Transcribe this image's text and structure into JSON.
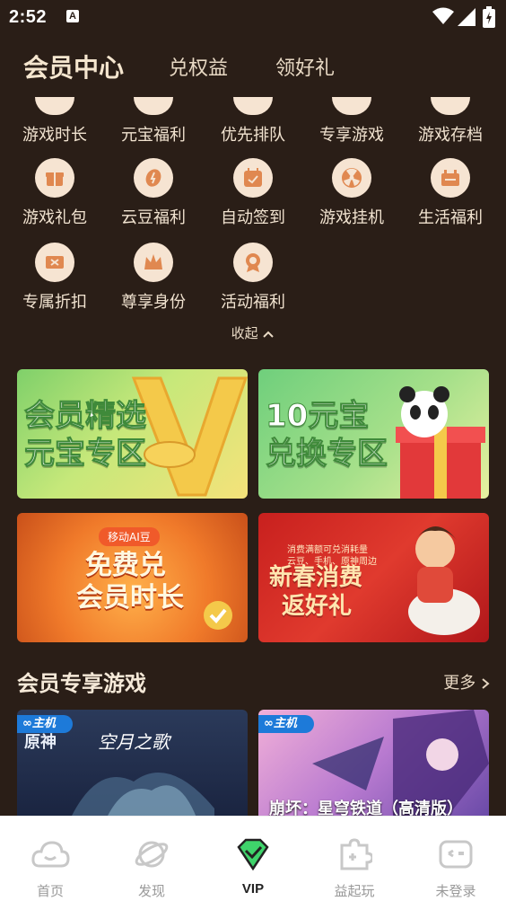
{
  "status": {
    "time": "2:52",
    "a_badge": "A"
  },
  "header": {
    "tabs": [
      {
        "label": "会员中心",
        "active": true
      },
      {
        "label": "兑权益",
        "active": false
      },
      {
        "label": "领好礼",
        "active": false
      }
    ]
  },
  "benefits": {
    "row0": [
      "游戏时长",
      "元宝福利",
      "优先排队",
      "专享游戏",
      "游戏存档"
    ],
    "row1": [
      "游戏礼包",
      "云豆福利",
      "自动签到",
      "游戏挂机",
      "生活福利"
    ],
    "row2": [
      "专属折扣",
      "尊享身份",
      "活动福利"
    ],
    "collapse_label": "收起"
  },
  "banners": [
    {
      "line1": "会员精选",
      "line2": "元宝专区"
    },
    {
      "line1": "10元宝",
      "line2": "兑换专区"
    },
    {
      "badge": "移动AI豆",
      "line1": "免费兑",
      "line2": "会员时长"
    },
    {
      "small": "消费满额可兑消耗量",
      "small2": "云豆、手机、原神周边",
      "line1": "新春消费",
      "line2": "返好礼"
    }
  ],
  "section": {
    "title": "会员专享游戏",
    "more": "更多"
  },
  "games": [
    {
      "tag": "主机",
      "logo": "原神",
      "subtitle": "空月之歌"
    },
    {
      "tag": "主机",
      "title": "崩坏：星穹铁道（高清版）"
    }
  ],
  "nav": [
    {
      "label": "首页",
      "icon": "cloud-icon"
    },
    {
      "label": "发现",
      "icon": "planet-icon"
    },
    {
      "label": "VIP",
      "icon": "vip-diamond-icon",
      "active": true
    },
    {
      "label": "益起玩",
      "icon": "puzzle-icon"
    },
    {
      "label": "未登录",
      "icon": "game-face-icon"
    }
  ],
  "colors": {
    "bg": "#2a1e17",
    "accent_green": "#3fd36b",
    "icon_bg": "#f6e4d2",
    "icon_fg": "#e08850"
  }
}
